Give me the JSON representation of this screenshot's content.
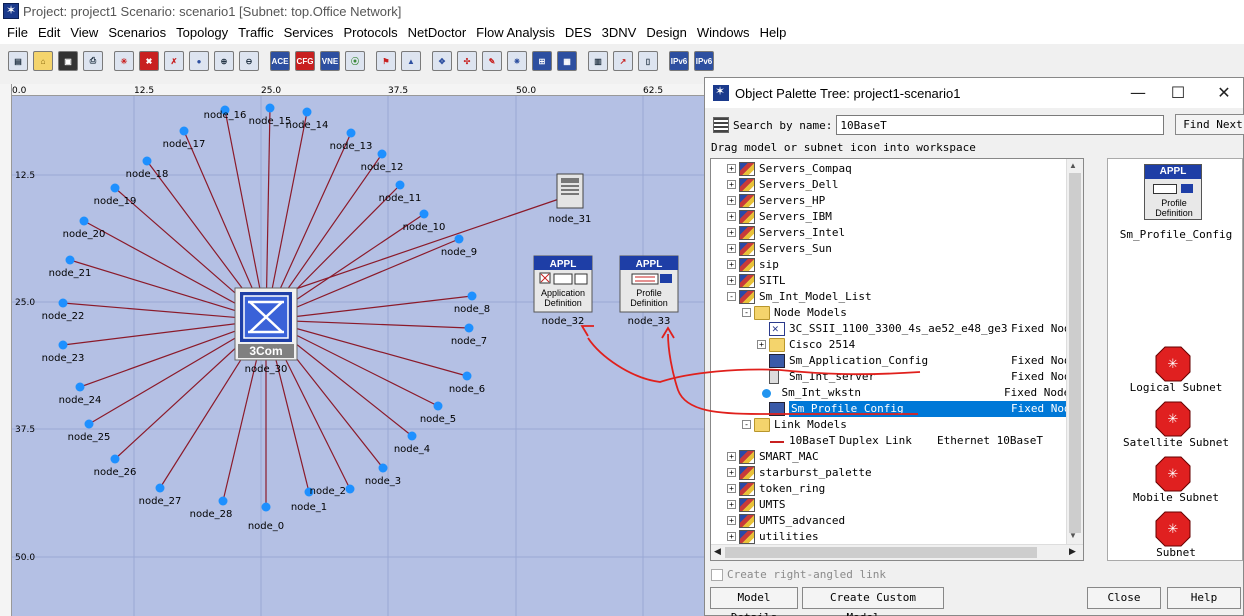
{
  "window": {
    "title": "Project: project1 Scenario: scenario1  [Subnet: top.Office Network]"
  },
  "menu": [
    "File",
    "Edit",
    "View",
    "Scenarios",
    "Topology",
    "Traffic",
    "Services",
    "Protocols",
    "NetDoctor",
    "Flow Analysis",
    "DES",
    "3DNV",
    "Design",
    "Windows",
    "Help"
  ],
  "toolbar": {
    "icons": [
      "new-project-icon",
      "open-icon",
      "save-icon",
      "print-icon",
      "topology-icon",
      "delete-icon",
      "fail-icon",
      "recover-icon",
      "zoom-in-icon",
      "zoom-out-icon",
      "ace-icon",
      "cfg-icon",
      "vne-icon",
      "traffic-light-icon",
      "flag-icon",
      "triangle-icon",
      "select-icon",
      "rubberband-icon",
      "wand-icon",
      "star-icon",
      "tree-icon",
      "ios-icon",
      "grid-icon",
      "chart-icon",
      "log-icon",
      "ipv6-icon",
      "ipv6-2-icon"
    ],
    "labels": {
      "ace": "ACE",
      "cfg": "CFG",
      "vne": "VNE",
      "ipv6": "IPv6"
    }
  },
  "workspace": {
    "ruler_x_labels": [
      "0.0",
      "12.5",
      "25.0",
      "37.5",
      "50.0",
      "62.5"
    ],
    "ruler_y_labels": [
      "12.5",
      "25.0",
      "37.5",
      "50.0"
    ],
    "hub_label": "3Com",
    "hub_name": "node_30",
    "server_name": "node_31",
    "app_config": {
      "badge": "APPL",
      "line1": "Application",
      "line2": "Definition",
      "name": "node_32"
    },
    "profile_config": {
      "badge": "APPL",
      "line1": "Profile",
      "line2": "Definition",
      "name": "node_33"
    },
    "star_nodes": [
      "node_0",
      "node_1",
      "node_2",
      "node_3",
      "node_4",
      "node_5",
      "node_6",
      "node_7",
      "node_8",
      "node_9",
      "node_10",
      "node_11",
      "node_12",
      "node_13",
      "node_14",
      "node_15",
      "node_16",
      "node_17",
      "node_18",
      "node_19",
      "node_20",
      "node_21",
      "node_22",
      "node_23",
      "node_24",
      "node_25",
      "node_26",
      "node_27",
      "node_28"
    ]
  },
  "palette": {
    "title": "Object Palette Tree: project1-scenario1",
    "search_label": "Search by name:",
    "search_value": "10BaseT",
    "find_next": "Find Next",
    "drag_hint": "Drag model or subnet icon into workspace",
    "tree": [
      {
        "label": "Servers_Compaq",
        "type": ""
      },
      {
        "label": "Servers_Dell",
        "type": ""
      },
      {
        "label": "Servers_HP",
        "type": ""
      },
      {
        "label": "Servers_IBM",
        "type": ""
      },
      {
        "label": "Servers_Intel",
        "type": ""
      },
      {
        "label": "Servers_Sun",
        "type": ""
      },
      {
        "label": "sip",
        "type": ""
      },
      {
        "label": "SITL",
        "type": ""
      },
      {
        "label": "Sm_Int_Model_List",
        "type": ""
      },
      {
        "label": "Node Models",
        "type": ""
      },
      {
        "label": "3C_SSII_1100_3300_4s_ae52_e48_ge3",
        "type": "Fixed Node"
      },
      {
        "label": "Cisco 2514",
        "type": ""
      },
      {
        "label": "Sm_Application_Config",
        "type": "Fixed Node"
      },
      {
        "label": "Sm_Int_server",
        "type": "Fixed Node"
      },
      {
        "label": "Sm_Int_wkstn",
        "type": "Fixed Node"
      },
      {
        "label": "Sm_Profile_Config",
        "type": "Fixed Node"
      },
      {
        "label": "Link Models",
        "type": ""
      },
      {
        "label": "10BaseT",
        "type": "Duplex Link",
        "extra": "Ethernet 10BaseT"
      },
      {
        "label": "SMART_MAC",
        "type": ""
      },
      {
        "label": "starburst_palette",
        "type": ""
      },
      {
        "label": "token_ring",
        "type": ""
      },
      {
        "label": "UMTS",
        "type": ""
      },
      {
        "label": "UMTS_advanced",
        "type": ""
      },
      {
        "label": "utilities",
        "type": ""
      }
    ],
    "preview": {
      "selected_badge": "APPL",
      "selected_line1": "Profile",
      "selected_line2": "Definition",
      "selected_name": "Sm_Profile_Config",
      "subnets": [
        "Logical Subnet",
        "Satellite Subnet",
        "Mobile Subnet",
        "Subnet"
      ]
    },
    "checkbox_label": "Create right-angled link",
    "buttons": {
      "model_details": "Model Details",
      "create_custom": "Create Custom Model...",
      "close": "Close",
      "help": "Help"
    }
  },
  "colors": {
    "canvas": "#b4c0e4",
    "link": "#8b1a2a",
    "node": "#1e90ff",
    "annotation": "#e0201c",
    "selection": "#0078d7"
  }
}
